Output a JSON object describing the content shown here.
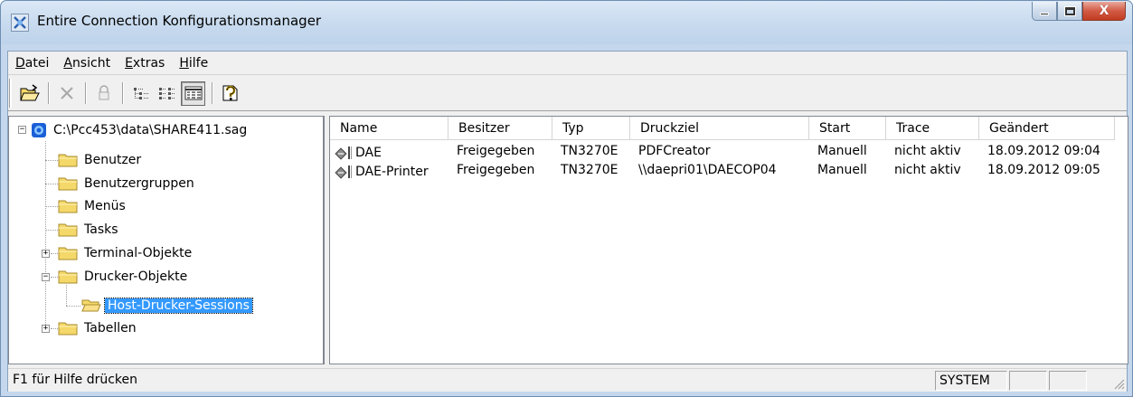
{
  "window": {
    "title": "Entire Connection Konfigurationsmanager",
    "close_glyph": "X"
  },
  "menu": [
    {
      "label": "Datei",
      "accel": "D",
      "rest": "atei"
    },
    {
      "label": "Ansicht",
      "accel": "A",
      "rest": "nsicht"
    },
    {
      "label": "Extras",
      "accel": "E",
      "rest": "xtras"
    },
    {
      "label": "Hilfe",
      "accel": "H",
      "rest": "ilfe"
    }
  ],
  "toolbar": {
    "buttons": [
      "open-folder-icon",
      "delete-x-icon",
      "lock-icon",
      "tree-view-icon",
      "list-view-icon",
      "details-view-icon",
      "help-icon"
    ]
  },
  "tree": {
    "root": "C:\\Pcc453\\data\\SHARE411.sag",
    "items": [
      {
        "label": "Benutzer"
      },
      {
        "label": "Benutzergruppen"
      },
      {
        "label": "Menüs"
      },
      {
        "label": "Tasks"
      },
      {
        "label": "Terminal-Objekte"
      },
      {
        "label": "Drucker-Objekte"
      },
      {
        "label": "Host-Drucker-Sessions"
      },
      {
        "label": "Tabellen"
      }
    ],
    "expander_plus": "+",
    "expander_minus": "−"
  },
  "list": {
    "columns": [
      "Name",
      "Besitzer",
      "Typ",
      "Druckziel",
      "Start",
      "Trace",
      "Geändert"
    ],
    "rows": [
      [
        "DAE",
        "Freigegeben",
        "TN3270E",
        "PDFCreator",
        "Manuell",
        "nicht aktiv",
        "18.09.2012 09:04"
      ],
      [
        "DAE-Printer",
        "Freigegeben",
        "TN3270E",
        "\\\\daepri01\\DAECOP04",
        "Manuell",
        "nicht aktiv",
        "18.09.2012 09:05"
      ]
    ]
  },
  "status": {
    "help_text": "F1 für Hilfe drücken",
    "user": "SYSTEM"
  },
  "colors": {
    "selection": "#3399ff",
    "folder": "#f4d86a",
    "titlebar": "#c6d9ee"
  }
}
